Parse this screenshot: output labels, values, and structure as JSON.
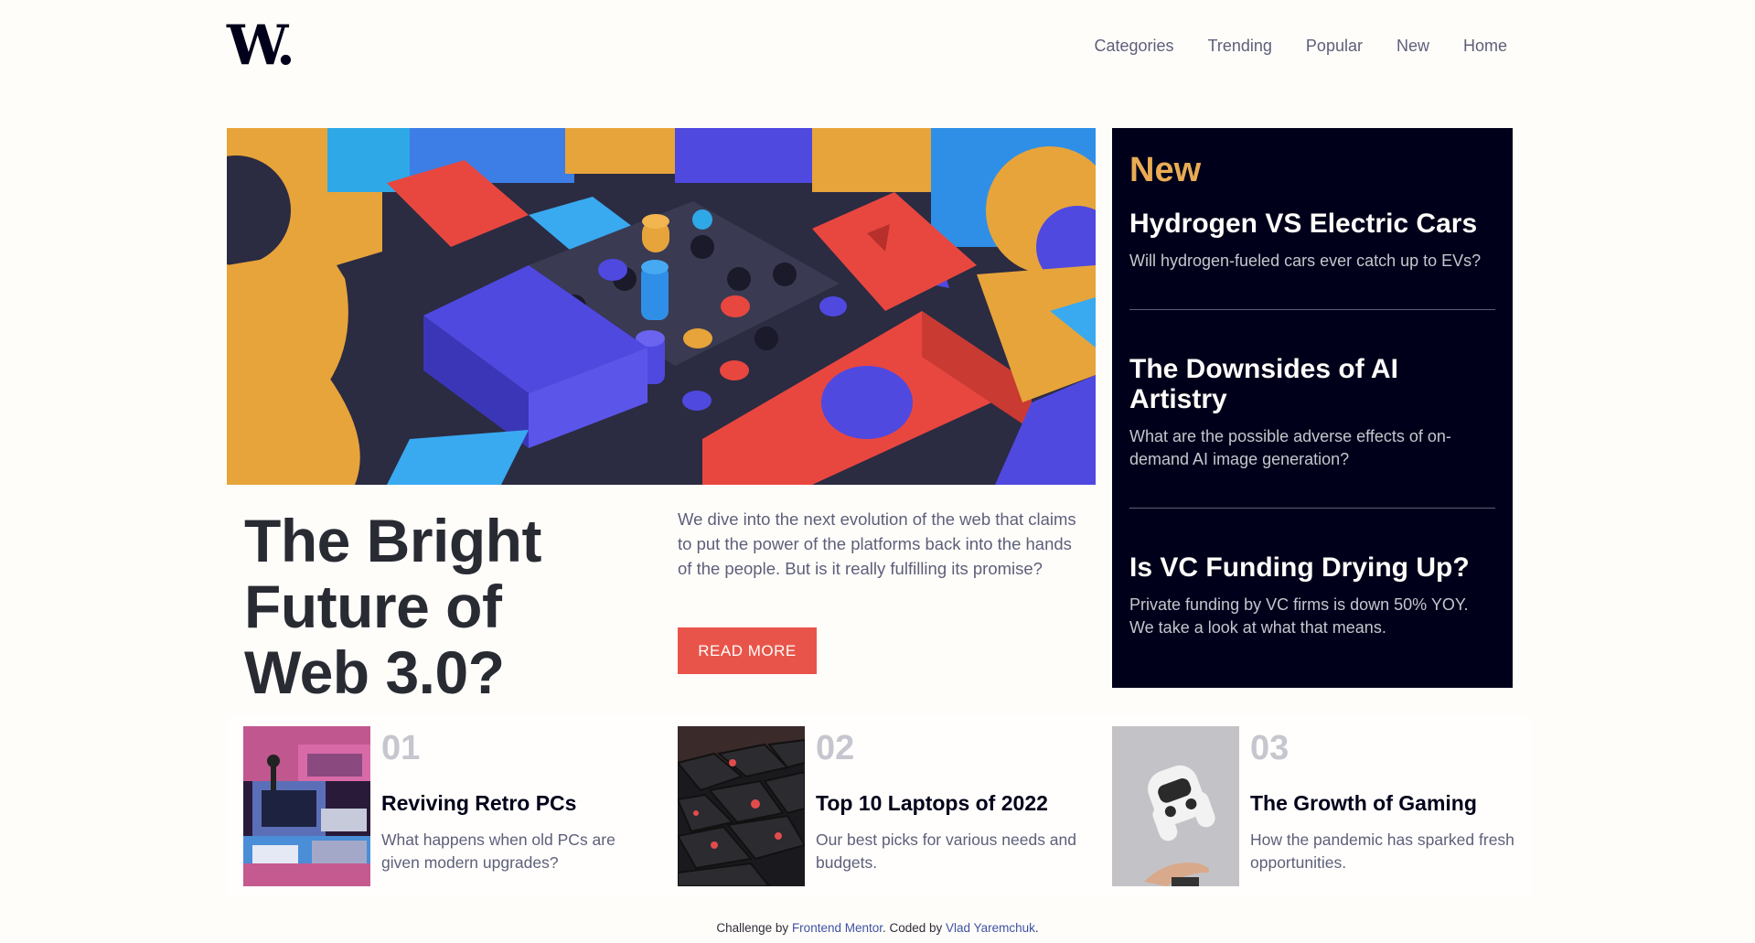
{
  "header": {
    "logo": "W.",
    "nav": [
      "Categories",
      "Trending",
      "Popular",
      "New",
      "Home"
    ]
  },
  "hero": {
    "title": "The Bright Future of Web 3.0?",
    "description": "We dive into the next evolution of the web that claims to put the power of the platforms back into the hands of the people. But is it really fulfilling its promise?",
    "button_label": "READ MORE"
  },
  "new_panel": {
    "heading": "New",
    "items": [
      {
        "title": "Hydrogen VS Electric Cars",
        "description": "Will hydrogen-fueled cars ever catch up to EVs?"
      },
      {
        "title": "The Downsides of AI Artistry",
        "description": "What are the possible adverse effects of on-demand AI image generation?"
      },
      {
        "title": "Is VC Funding Drying Up?",
        "description": "Private funding by VC firms is down 50% YOY. We take a look at what that means."
      }
    ]
  },
  "articles": [
    {
      "number": "01",
      "title": "Reviving Retro PCs",
      "description": "What happens when old PCs are given modern upgrades?"
    },
    {
      "number": "02",
      "title": "Top 10 Laptops of 2022",
      "description": "Our best picks for various needs and budgets."
    },
    {
      "number": "03",
      "title": "The Growth of Gaming",
      "description": "How the pandemic has sparked fresh opportunities."
    }
  ],
  "attribution": {
    "prefix": "Challenge by ",
    "challenge_link": "Frontend Mentor",
    "middle": ". Coded by ",
    "author_link": "Vlad Yaremchuk",
    "suffix": "."
  },
  "colors": {
    "accent_red": "#e9544a",
    "accent_orange": "#e9ab53",
    "dark_navy": "#00001a",
    "grayish_blue": "#5d5f79",
    "off_white": "#fffdfa"
  }
}
